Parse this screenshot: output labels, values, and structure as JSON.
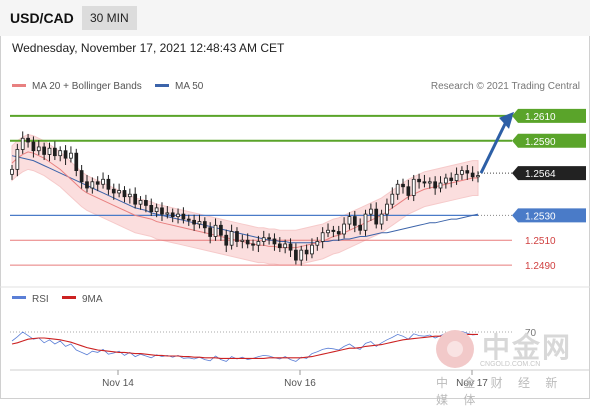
{
  "header": {
    "symbol": "USD/CAD",
    "timeframe": "30 MIN"
  },
  "timestamp": "Wednesday, November 17, 2021 12:48:43 AM CET",
  "legend": {
    "bb_label": "MA 20 + Bollinger Bands",
    "ma50_label": "MA 50",
    "credit": "Research © 2021 Trading Central"
  },
  "rsi_legend": {
    "rsi_label": "RSI",
    "ma_label": "9MA"
  },
  "watermark": {
    "brand": "中金网",
    "tagline": "中 金 财 经 新 媒 体",
    "url": "CNGOLD.COM.CN"
  },
  "colors": {
    "resistance": "#5aa42a",
    "support": "#e87b7b",
    "pivot": "#4a7bc8",
    "current": "#222222",
    "arrow": "#2d5fa6",
    "ma20": "#e88080",
    "ma50": "#3c64aa",
    "bb_fill": "#fbdede",
    "candle": "#1e1e1e",
    "rsi": "#5b7fd6",
    "rsi_ma": "#cc2222"
  },
  "chart_data": [
    {
      "type": "candlestick",
      "title": "USD/CAD",
      "x_ticks": [
        "Nov 14",
        "Nov 16",
        "Nov 17"
      ],
      "levels": [
        {
          "value": 1.261,
          "label": "1.2610",
          "kind": "resistance"
        },
        {
          "value": 1.259,
          "label": "1.2590",
          "kind": "resistance"
        },
        {
          "value": 1.2564,
          "label": "1.2564",
          "kind": "current"
        },
        {
          "value": 1.253,
          "label": "1.2530",
          "kind": "pivot"
        },
        {
          "value": 1.251,
          "label": "1.2510",
          "kind": "support"
        },
        {
          "value": 1.249,
          "label": "1.2490",
          "kind": "support"
        }
      ],
      "ylim": [
        1.2478,
        1.2626
      ],
      "close": [
        1.2567,
        1.2583,
        1.2592,
        1.2589,
        1.2582,
        1.2585,
        1.2579,
        1.2584,
        1.2578,
        1.2582,
        1.2576,
        1.258,
        1.2566,
        1.2557,
        1.2552,
        1.2557,
        1.2555,
        1.2559,
        1.2551,
        1.2548,
        1.255,
        1.2545,
        1.2547,
        1.2539,
        1.2542,
        1.2538,
        1.2533,
        1.2536,
        1.2531,
        1.2532,
        1.2529,
        1.2531,
        1.2527,
        1.2526,
        1.2523,
        1.2525,
        1.252,
        1.2513,
        1.2522,
        1.2514,
        1.2506,
        1.2517,
        1.2509,
        1.251,
        1.2507,
        1.2506,
        1.2509,
        1.2512,
        1.2511,
        1.2507,
        1.2504,
        1.2507,
        1.2502,
        1.2494,
        1.2502,
        1.2499,
        1.2506,
        1.2509,
        1.2516,
        1.2518,
        1.2517,
        1.2515,
        1.2523,
        1.2529,
        1.2522,
        1.2518,
        1.2531,
        1.2535,
        1.2523,
        1.2531,
        1.2539,
        1.2547,
        1.2555,
        1.2553,
        1.2546,
        1.2559,
        1.2557,
        1.2556,
        1.2557,
        1.2552,
        1.2556,
        1.256,
        1.2558,
        1.2563,
        1.2566,
        1.2564,
        1.2561,
        1.2562
      ],
      "ma20": [
        1.2572,
        1.2576,
        1.2579,
        1.2581,
        1.258,
        1.2578,
        1.2576,
        1.2573,
        1.257,
        1.2567,
        1.2563,
        1.2559,
        1.2555,
        1.2551,
        1.2548,
        1.2546,
        1.2544,
        1.2542,
        1.254,
        1.2538,
        1.2536,
        1.2534,
        1.2532,
        1.253,
        1.2529,
        1.2528,
        1.2527,
        1.2525,
        1.2524,
        1.2523,
        1.2522,
        1.2521,
        1.252,
        1.2519,
        1.2518,
        1.2517,
        1.2516,
        1.2515,
        1.2514,
        1.2513,
        1.2512,
        1.2511,
        1.251,
        1.2509,
        1.2508,
        1.2507,
        1.2506,
        1.2506,
        1.2505,
        1.2505,
        1.2504,
        1.2504,
        1.2504,
        1.2504,
        1.2505,
        1.2506,
        1.2507,
        1.2508,
        1.2509,
        1.2511,
        1.2513,
        1.2514,
        1.2516,
        1.2518,
        1.252,
        1.2522,
        1.2524,
        1.2526,
        1.2528,
        1.253,
        1.2533,
        1.2536,
        1.2539,
        1.2542,
        1.2545,
        1.2547,
        1.2549,
        1.2551,
        1.2552,
        1.2553,
        1.2554,
        1.2555,
        1.2556,
        1.2557,
        1.2558,
        1.2559,
        1.256,
        1.256
      ],
      "ma50": [
        1.2578,
        1.2577,
        1.2576,
        1.2575,
        1.2574,
        1.2572,
        1.257,
        1.2568,
        1.2566,
        1.2564,
        1.2562,
        1.256,
        1.2558,
        1.2556,
        1.2554,
        1.2552,
        1.255,
        1.2548,
        1.2546,
        1.2544,
        1.2542,
        1.254,
        1.2538,
        1.2536,
        1.2535,
        1.2534,
        1.2532,
        1.2531,
        1.253,
        1.2529,
        1.2528,
        1.2527,
        1.2526,
        1.2525,
        1.2524,
        1.2523,
        1.2522,
        1.2521,
        1.252,
        1.2519,
        1.2518,
        1.2517,
        1.2516,
        1.2515,
        1.2514,
        1.2513,
        1.2512,
        1.2511,
        1.251,
        1.251,
        1.2509,
        1.2509,
        1.2508,
        1.2508,
        1.2508,
        1.2508,
        1.2508,
        1.2508,
        1.2509,
        1.2509,
        1.251,
        1.251,
        1.2511,
        1.2511,
        1.2512,
        1.2513,
        1.2513,
        1.2514,
        1.2515,
        1.2516,
        1.2516,
        1.2517,
        1.2518,
        1.2519,
        1.252,
        1.2521,
        1.2522,
        1.2523,
        1.2524,
        1.2524,
        1.2525,
        1.2526,
        1.2527,
        1.2527,
        1.2528,
        1.2529,
        1.253,
        1.2531
      ],
      "bb_width": 0.0014,
      "projection": {
        "from": 1.2564,
        "to": 1.261
      }
    },
    {
      "type": "line",
      "title": "RSI",
      "ylim": [
        0,
        100
      ],
      "y_ticks": [
        "70"
      ],
      "series": [
        {
          "name": "RSI",
          "values": [
            55,
            62,
            70,
            64,
            58,
            60,
            52,
            57,
            50,
            55,
            46,
            50,
            40,
            36,
            32,
            38,
            36,
            41,
            33,
            35,
            38,
            31,
            36,
            29,
            33,
            30,
            27,
            32,
            29,
            31,
            28,
            31,
            26,
            27,
            25,
            28,
            24,
            22,
            30,
            24,
            21,
            29,
            25,
            28,
            24,
            26,
            29,
            31,
            30,
            27,
            25,
            29,
            24,
            21,
            28,
            26,
            34,
            37,
            41,
            43,
            42,
            40,
            46,
            50,
            44,
            41,
            51,
            54,
            46,
            52,
            57,
            61,
            66,
            63,
            58,
            67,
            64,
            63,
            65,
            60,
            64,
            68,
            64,
            69,
            71,
            68,
            65,
            66
          ]
        },
        {
          "name": "9MA",
          "values": [
            50,
            52,
            55,
            58,
            59,
            60,
            60,
            59,
            58,
            57,
            55,
            53,
            50,
            47,
            44,
            42,
            40,
            39,
            38,
            37,
            36,
            36,
            35,
            34,
            34,
            33,
            32,
            31,
            31,
            30,
            30,
            30,
            29,
            29,
            28,
            28,
            27,
            27,
            27,
            26,
            26,
            26,
            26,
            26,
            26,
            26,
            26,
            26,
            27,
            27,
            27,
            27,
            27,
            27,
            27,
            28,
            29,
            31,
            33,
            35,
            37,
            39,
            41,
            43,
            43,
            44,
            46,
            47,
            48,
            49,
            51,
            53,
            55,
            57,
            58,
            59,
            60,
            61,
            62,
            63,
            63,
            64,
            64,
            65,
            66,
            66,
            66,
            66
          ]
        }
      ]
    }
  ]
}
